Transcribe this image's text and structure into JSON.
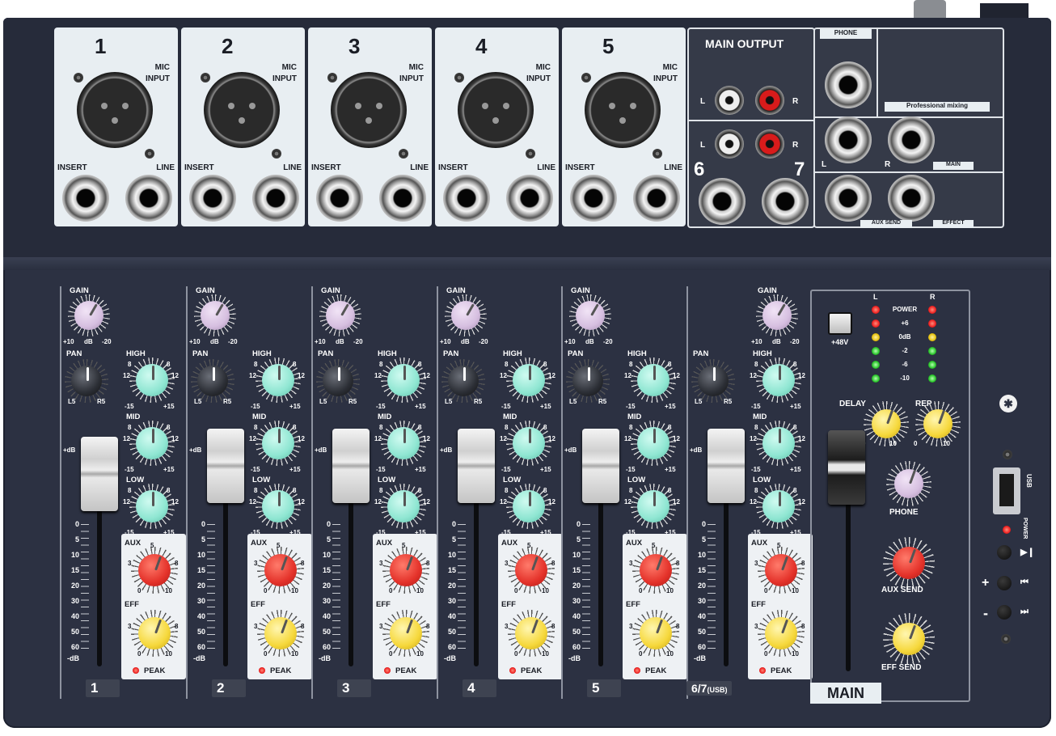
{
  "channels": [
    {
      "num": "1",
      "mic": "MIC",
      "input": "INPUT",
      "insert": "INSERT",
      "line": "LINE",
      "tag": "1"
    },
    {
      "num": "2",
      "mic": "MIC",
      "input": "INPUT",
      "insert": "INSERT",
      "line": "LINE",
      "tag": "2"
    },
    {
      "num": "3",
      "mic": "MIC",
      "input": "INPUT",
      "insert": "INSERT",
      "line": "LINE",
      "tag": "3"
    },
    {
      "num": "4",
      "mic": "MIC",
      "input": "INPUT",
      "insert": "INSERT",
      "line": "LINE",
      "tag": "4"
    },
    {
      "num": "5",
      "mic": "MIC",
      "input": "INPUT",
      "insert": "INSERT",
      "line": "LINE",
      "tag": "5"
    }
  ],
  "rear": {
    "main_output": "MAIN OUTPUT",
    "l": "L",
    "r": "R",
    "six": "6",
    "seven": "7",
    "phone": "PHONE",
    "professional": "Professional mixing",
    "main": "MAIN",
    "aux_send": "AUX SEND",
    "effect": "EFFECT"
  },
  "strip": {
    "gain": "GAIN",
    "pan": "PAN",
    "high": "HIGH",
    "mid": "MID",
    "low": "LOW",
    "aux": "AUX",
    "eff": "EFF",
    "peak": "PEAK",
    "gain_min": "+10",
    "gain_db": "dB",
    "gain_max": "-20",
    "pan_l": "L5",
    "pan_r": "R5",
    "eq_min": "-15",
    "eq_max": "+15",
    "eq_12": "12",
    "eq_8": "8",
    "eq_4": "4",
    "send_0": "0",
    "send_3": "3",
    "send_5": "5",
    "send_8": "8",
    "send_10": "10",
    "fader_scale": [
      "0",
      "5",
      "10",
      "15",
      "20",
      "30",
      "40",
      "50",
      "60"
    ],
    "fader_db": "-dB",
    "fader_top": "+dB",
    "stereo_tag": "6/7",
    "usb_tag": "(USB)"
  },
  "master": {
    "plus48": "+48V",
    "meter_l": "L",
    "meter_r": "R",
    "meter_rows": [
      "POWER",
      "+6",
      "0dB",
      "-2",
      "-6",
      "-10"
    ],
    "delay": "DELAY",
    "rep": "REP",
    "zero": "0",
    "ten": "10",
    "phone": "PHONE",
    "aux_send": "AUX SEND",
    "eff_send": "EFF SEND",
    "main": "MAIN"
  },
  "usb": {
    "usb_label": "USB",
    "power": "POWER",
    "plus": "+",
    "minus": "-",
    "bt_icon": "bluetooth-icon"
  },
  "colors": {
    "chassis": "#2c3142",
    "panel": "#e8eef2"
  }
}
